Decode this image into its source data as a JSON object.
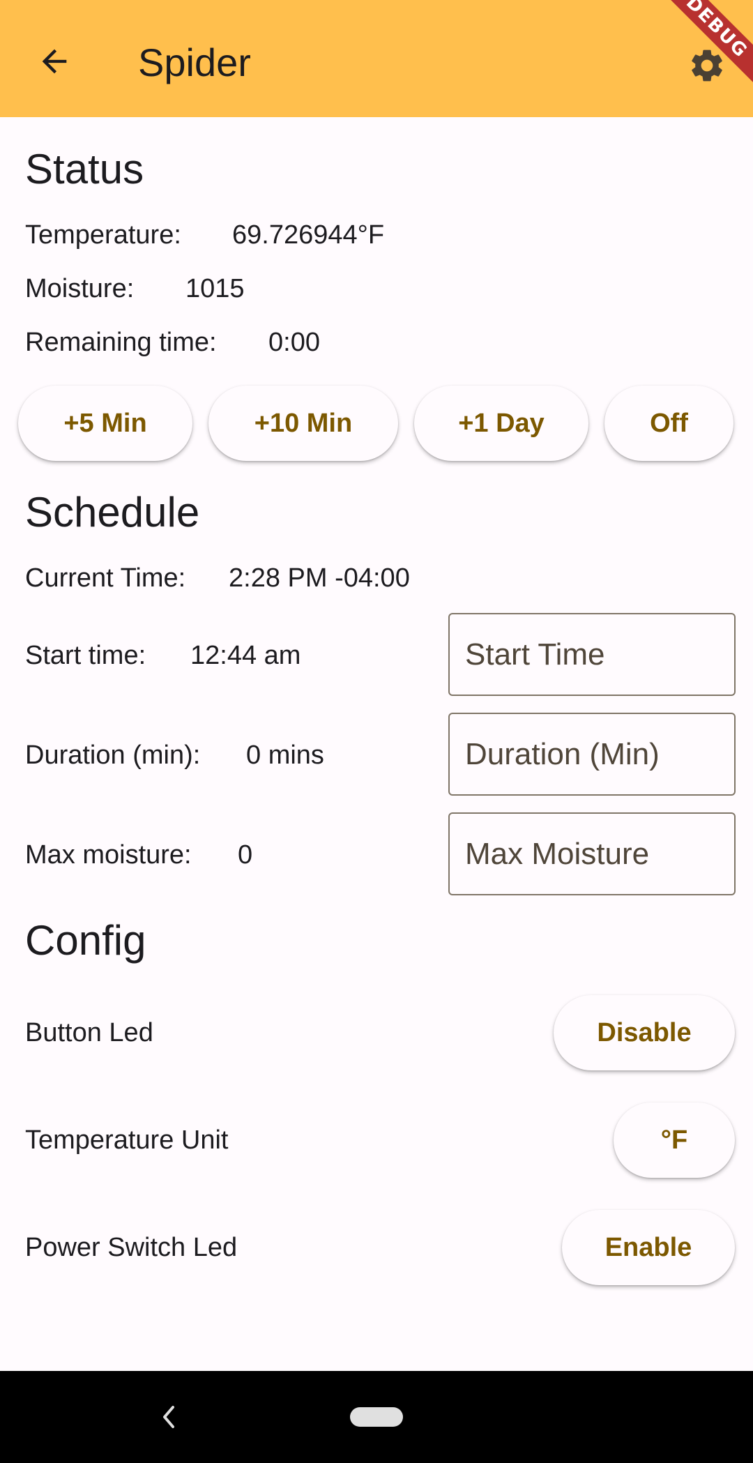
{
  "app_bar": {
    "title": "Spider",
    "back_icon": "arrow-left-icon",
    "settings_icon": "gear-icon",
    "debug_banner": "DEBUG",
    "color": "#ffbf4d"
  },
  "status": {
    "title": "Status",
    "temperature_label": "Temperature:",
    "temperature_value": "69.726944°F",
    "moisture_label": "Moisture:",
    "moisture_value": "1015",
    "remaining_label": "Remaining time:",
    "remaining_value": "0:00",
    "buttons": [
      "+5 Min",
      "+10 Min",
      "+1 Day",
      "Off"
    ]
  },
  "schedule": {
    "title": "Schedule",
    "current_time_label": "Current Time:",
    "current_time_value": "2:28 PM -04:00",
    "start_time_label": "Start time:",
    "start_time_value": "12:44 am",
    "start_time_placeholder": "Start Time",
    "duration_label": "Duration (min):",
    "duration_value": "0 mins",
    "duration_placeholder": "Duration (Min)",
    "max_moisture_label": "Max moisture:",
    "max_moisture_value": "0",
    "max_moisture_placeholder": "Max Moisture"
  },
  "config": {
    "title": "Config",
    "button_led_label": "Button Led",
    "button_led_action": "Disable",
    "temperature_unit_label": "Temperature Unit",
    "temperature_unit_action": "°F",
    "power_switch_led_label": "Power Switch Led",
    "power_switch_led_action": "Enable"
  },
  "colors": {
    "accent_text": "#7c5800",
    "outline": "#7f7567"
  }
}
